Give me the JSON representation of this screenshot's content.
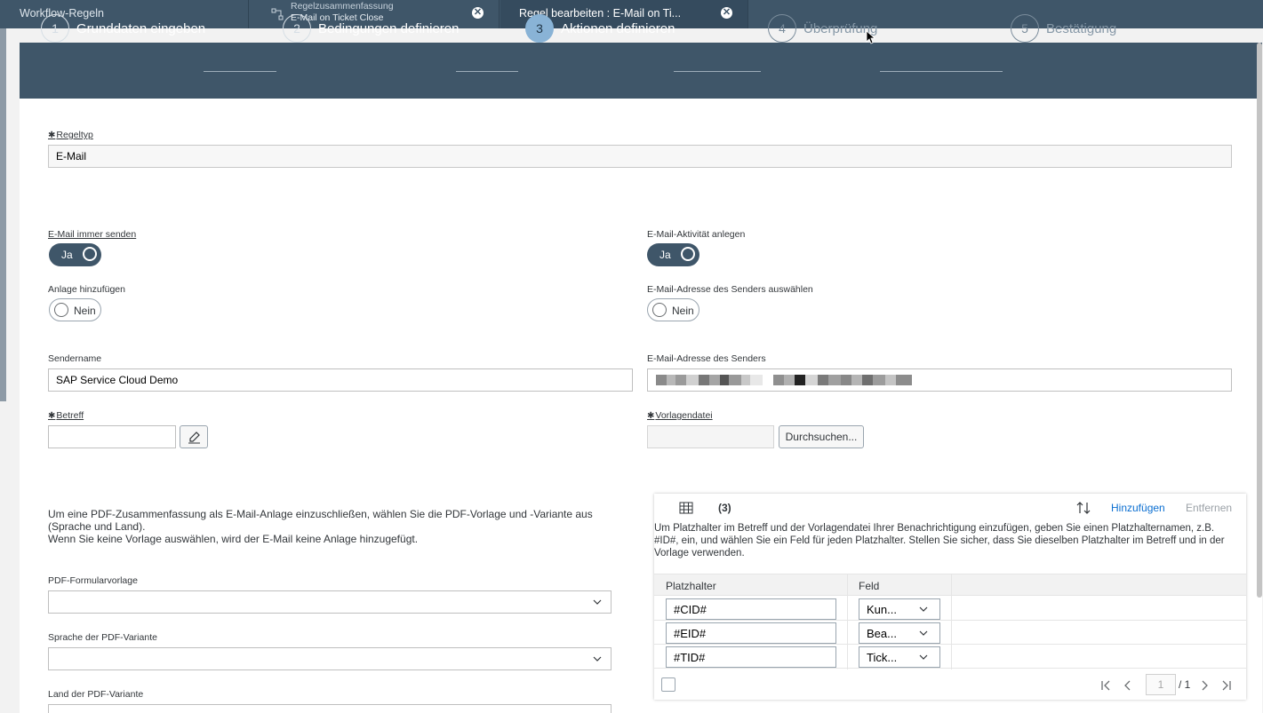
{
  "tabs": {
    "home_label": "Workflow-Regeln",
    "summary_line1": "Regelzusammenfassung",
    "summary_line2": "E-Mail on Ticket Close",
    "edit_label": "Regel bearbeiten : E-Mail on Ti...",
    "close_glyph": "✕"
  },
  "wizard": {
    "steps": [
      {
        "num": "1",
        "label": "Grunddaten eingeben",
        "state": "done"
      },
      {
        "num": "2",
        "label": "Bedingungen definieren",
        "state": "done"
      },
      {
        "num": "3",
        "label": "Aktionen definieren",
        "state": "active"
      },
      {
        "num": "4",
        "label": "Überprüfung",
        "state": "todo"
      },
      {
        "num": "5",
        "label": "Bestätigung",
        "state": "todo"
      }
    ]
  },
  "form": {
    "required_mark": "✱",
    "regeltyp_label": "Regeltyp",
    "regeltyp_value": "E-Mail",
    "email_always_label": "E-Mail immer senden",
    "email_always_value": "Ja",
    "email_activity_label": "E-Mail-Aktivität anlegen",
    "email_activity_value": "Ja",
    "attachment_label": "Anlage hinzufügen",
    "attachment_value": "Nein",
    "sender_select_label": "E-Mail-Adresse des Senders auswählen",
    "sender_select_value": "Nein",
    "sendername_label": "Sendername",
    "sendername_value": "SAP Service Cloud Demo",
    "sender_address_label": "E-Mail-Adresse des Senders",
    "betreff_label": "Betreff",
    "betreff_value": "",
    "vorlage_label": "Vorlagendatei",
    "vorlage_value": "",
    "browse_button": "Durchsuchen...",
    "pdf_info_line1": "Um eine PDF-Zusammenfassung als E-Mail-Anlage einzuschließen, wählen Sie die PDF-Vorlage und -Variante aus",
    "pdf_info_line2": "(Sprache und Land).",
    "pdf_info_line3": "Wenn Sie keine Vorlage auswählen, wird der E-Mail keine Anlage hinzugefügt.",
    "pdf_template_label": "PDF-Formularvorlage",
    "pdf_language_label": "Sprache der PDF-Variante",
    "pdf_country_label": "Land der PDF-Variante"
  },
  "placeholder_table": {
    "count": "(3)",
    "add_label": "Hinzufügen",
    "remove_label": "Entfernen",
    "hint_line1": "Um Platzhalter im Betreff und der Vorlagendatei Ihrer Benachrichtigung einzufügen, geben Sie einen Platzhalternamen, z.B.",
    "hint_line2": "#ID#, ein, und wählen Sie ein Feld für jeden Platzhalter. Stellen Sie sicher, dass Sie dieselben Platzhalter im Betreff und in der",
    "hint_line3": "Vorlage verwenden.",
    "col_placeholder": "Platzhalter",
    "col_field": "Feld",
    "rows": [
      {
        "placeholder": "#CID#",
        "field": "Kun..."
      },
      {
        "placeholder": "#EID#",
        "field": "Bea..."
      },
      {
        "placeholder": "#TID#",
        "field": "Tick..."
      }
    ],
    "pager_page": "1",
    "pager_total": "/ 1"
  },
  "colors": {
    "header_bg": "#3f5669",
    "active_step": "#89b3d6",
    "link": "#0a6ed1"
  }
}
